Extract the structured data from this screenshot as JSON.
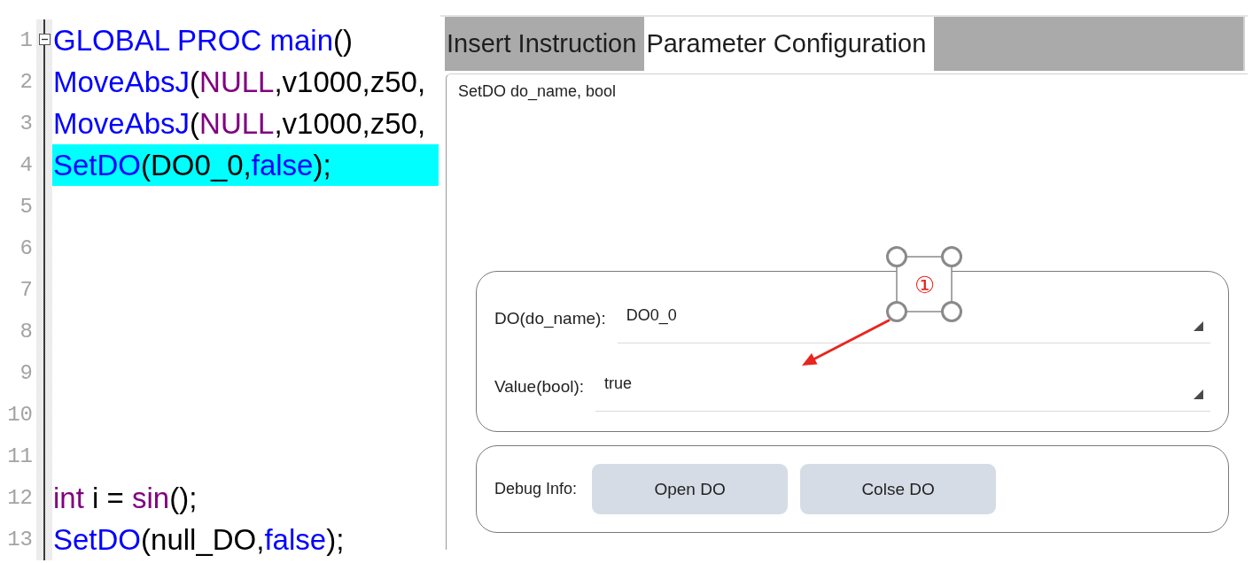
{
  "editor": {
    "lines": [
      {
        "number": "1",
        "fold_marker": {
          "expanded": true
        },
        "selected": false,
        "tokens": [
          {
            "text": "GLOBAL PROC main",
            "kind": "keyword"
          },
          {
            "text": "()",
            "kind": "plain"
          }
        ]
      },
      {
        "number": "2",
        "selected": false,
        "tokens": [
          {
            "text": "MoveAbsJ",
            "kind": "keyword"
          },
          {
            "text": "(",
            "kind": "plain"
          },
          {
            "text": "NULL",
            "kind": "builtin"
          },
          {
            "text": ",v1000,z50,",
            "kind": "plain"
          }
        ]
      },
      {
        "number": "3",
        "selected": false,
        "tokens": [
          {
            "text": "MoveAbsJ",
            "kind": "keyword"
          },
          {
            "text": "(",
            "kind": "plain"
          },
          {
            "text": "NULL",
            "kind": "builtin"
          },
          {
            "text": ",v1000,z50,",
            "kind": "plain"
          }
        ]
      },
      {
        "number": "4",
        "selected": true,
        "tokens": [
          {
            "text": "SetDO",
            "kind": "keyword"
          },
          {
            "text": "(DO0_0,",
            "kind": "plain"
          },
          {
            "text": "false",
            "kind": "keyword"
          },
          {
            "text": ");",
            "kind": "plain"
          }
        ]
      },
      {
        "number": "5",
        "selected": false
      },
      {
        "number": "6",
        "selected": false
      },
      {
        "number": "7",
        "selected": false
      },
      {
        "number": "8",
        "selected": false
      },
      {
        "number": "9",
        "selected": false
      },
      {
        "number": "10",
        "selected": false
      },
      {
        "number": "11",
        "selected": false
      },
      {
        "number": "12",
        "selected": false,
        "tokens": [
          {
            "text": "int",
            "kind": "builtin"
          },
          {
            "text": " i = ",
            "kind": "plain"
          },
          {
            "text": "sin",
            "kind": "builtin"
          },
          {
            "text": "();",
            "kind": "plain"
          }
        ]
      },
      {
        "number": "13",
        "selected": false,
        "tokens": [
          {
            "text": "SetDO",
            "kind": "keyword"
          },
          {
            "text": "(null_DO,",
            "kind": "plain"
          },
          {
            "text": "false",
            "kind": "keyword"
          },
          {
            "text": ");",
            "kind": "plain"
          }
        ]
      }
    ]
  },
  "panel": {
    "tabs": [
      {
        "label": "Insert Instruction",
        "selected": false
      },
      {
        "label": "Parameter Configuration",
        "selected": true
      }
    ],
    "signature": "SetDO do_name, bool",
    "parameters": [
      {
        "label": "DO(do_name):",
        "value": "DO0_0"
      },
      {
        "label": "Value(bool):",
        "value": "true"
      }
    ],
    "debug": {
      "label": "Debug Info:",
      "buttons": [
        "Open DO",
        "Colse DO"
      ]
    }
  },
  "annotation": {
    "label": "①"
  }
}
